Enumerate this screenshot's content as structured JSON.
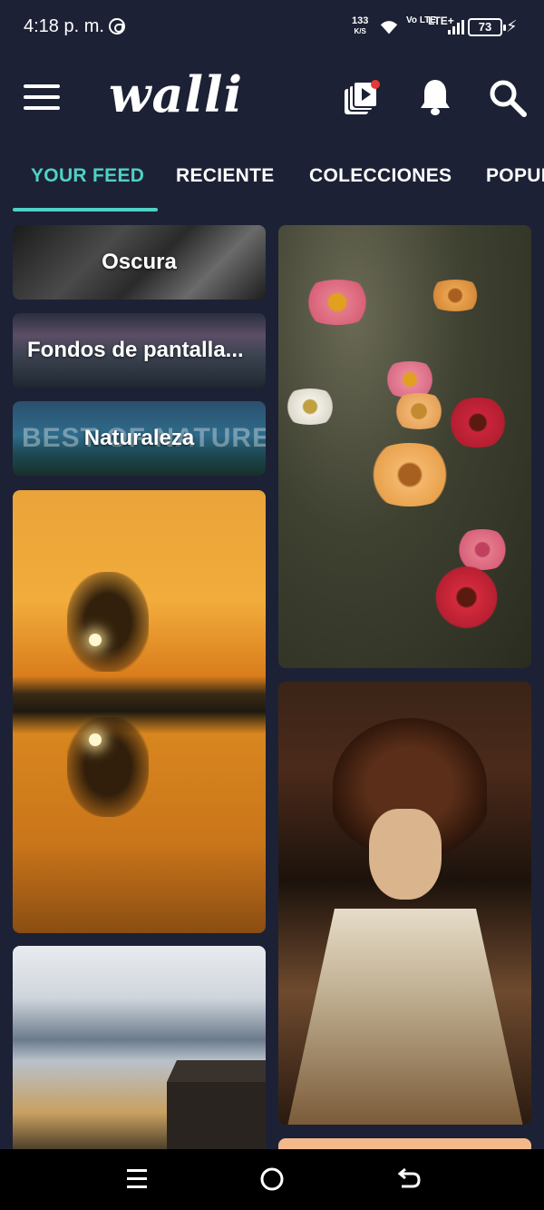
{
  "status_bar": {
    "time": "4:18 p. m.",
    "net_speed": "133",
    "net_unit": "K/S",
    "volte": "Vo LTE",
    "lte": "LTE+",
    "battery": "73"
  },
  "app": {
    "logo": "walli"
  },
  "tabs": [
    {
      "label": "YOUR FEED",
      "active": true
    },
    {
      "label": "RECIENTE",
      "active": false
    },
    {
      "label": "COLECCIONES",
      "active": false
    },
    {
      "label": "POPULAR",
      "active": false
    }
  ],
  "feed": {
    "collections": [
      {
        "label": "Oscura"
      },
      {
        "label": "Fondos de pantalla..."
      },
      {
        "label": "Naturaleza",
        "overlay_text": "BEST OF NATURE"
      }
    ],
    "wallpapers": [
      {
        "name": "sunset-lake"
      },
      {
        "name": "cloudy-sky-village"
      },
      {
        "name": "zinnia-flowers"
      },
      {
        "name": "anime-samurai"
      },
      {
        "name": "peach-wallpaper"
      }
    ]
  },
  "colors": {
    "background": "#1d2135",
    "accent": "#4fd1c5",
    "notification_dot": "#e53935"
  }
}
